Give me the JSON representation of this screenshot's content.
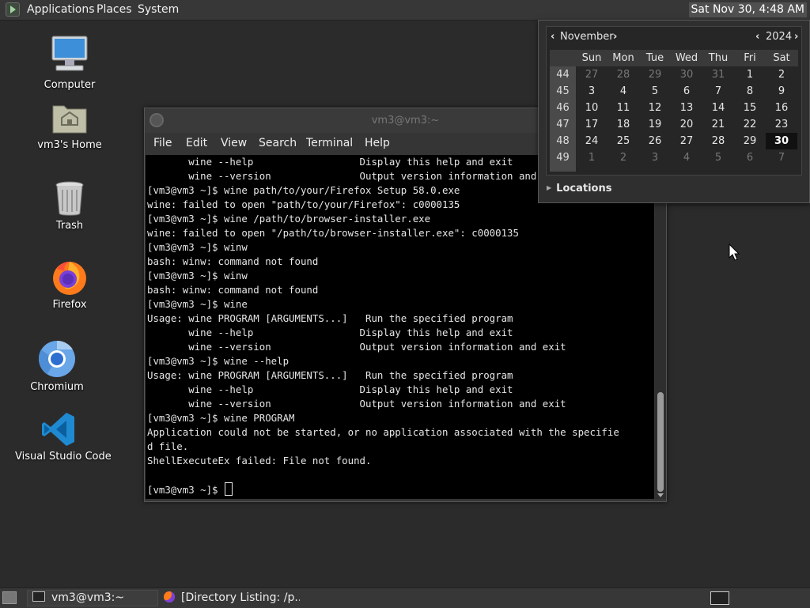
{
  "top_panel": {
    "menus": [
      "Applications",
      "Places",
      "System"
    ],
    "clock": "Sat Nov 30,  4:48 AM"
  },
  "desktop_icons": [
    {
      "label": "Computer",
      "icon": "computer-icon"
    },
    {
      "label": "vm3's Home",
      "icon": "home-folder-icon"
    },
    {
      "label": "Trash",
      "icon": "trash-icon"
    },
    {
      "label": "Firefox",
      "icon": "firefox-icon"
    },
    {
      "label": "Chromium",
      "icon": "chromium-icon"
    },
    {
      "label": "Visual Studio Code",
      "icon": "vscode-icon"
    }
  ],
  "terminal": {
    "title": "vm3@vm3:~",
    "menu": [
      "File",
      "Edit",
      "View",
      "Search",
      "Terminal",
      "Help"
    ],
    "lines": [
      "       wine --help                  Display this help and exit",
      "       wine --version               Output version information and exit",
      "[vm3@vm3 ~]$ wine path/to/your/Firefox Setup 58.0.exe",
      "wine: failed to open \"path/to/your/Firefox\": c0000135",
      "[vm3@vm3 ~]$ wine /path/to/browser-installer.exe",
      "wine: failed to open \"/path/to/browser-installer.exe\": c0000135",
      "[vm3@vm3 ~]$ winw",
      "bash: winw: command not found",
      "[vm3@vm3 ~]$ winw",
      "bash: winw: command not found",
      "[vm3@vm3 ~]$ wine",
      "Usage: wine PROGRAM [ARGUMENTS...]   Run the specified program",
      "       wine --help                  Display this help and exit",
      "       wine --version               Output version information and exit",
      "[vm3@vm3 ~]$ wine --help",
      "Usage: wine PROGRAM [ARGUMENTS...]   Run the specified program",
      "       wine --help                  Display this help and exit",
      "       wine --version               Output version information and exit",
      "[vm3@vm3 ~]$ wine PROGRAM",
      "Application could not be started, or no application associated with the specifie",
      "d file.",
      "ShellExecuteEx failed: File not found.",
      ""
    ],
    "prompt": "[vm3@vm3 ~]$ "
  },
  "calendar": {
    "month": "November",
    "year": "2024",
    "day_names": [
      "Sun",
      "Mon",
      "Tue",
      "Wed",
      "Thu",
      "Fri",
      "Sat"
    ],
    "weeks": [
      {
        "num": "44",
        "days": [
          "27",
          "28",
          "29",
          "30",
          "31",
          "1",
          "2"
        ],
        "dim": [
          true,
          true,
          true,
          true,
          true,
          false,
          false
        ]
      },
      {
        "num": "45",
        "days": [
          "3",
          "4",
          "5",
          "6",
          "7",
          "8",
          "9"
        ],
        "dim": [
          false,
          false,
          false,
          false,
          false,
          false,
          false
        ]
      },
      {
        "num": "46",
        "days": [
          "10",
          "11",
          "12",
          "13",
          "14",
          "15",
          "16"
        ],
        "dim": [
          false,
          false,
          false,
          false,
          false,
          false,
          false
        ]
      },
      {
        "num": "47",
        "days": [
          "17",
          "18",
          "19",
          "20",
          "21",
          "22",
          "23"
        ],
        "dim": [
          false,
          false,
          false,
          false,
          false,
          false,
          false
        ]
      },
      {
        "num": "48",
        "days": [
          "24",
          "25",
          "26",
          "27",
          "28",
          "29",
          "30"
        ],
        "dim": [
          false,
          false,
          false,
          false,
          false,
          false,
          false
        ]
      },
      {
        "num": "49",
        "days": [
          "1",
          "2",
          "3",
          "4",
          "5",
          "6",
          "7"
        ],
        "dim": [
          true,
          true,
          true,
          true,
          true,
          true,
          true
        ]
      }
    ],
    "today": "30",
    "locations_label": "Locations"
  },
  "taskbar": {
    "tasks": [
      {
        "label": "vm3@vm3:~",
        "icon": "terminal-icon"
      },
      {
        "label": "[Directory Listing: /p...",
        "icon": "firefox-icon"
      }
    ]
  }
}
